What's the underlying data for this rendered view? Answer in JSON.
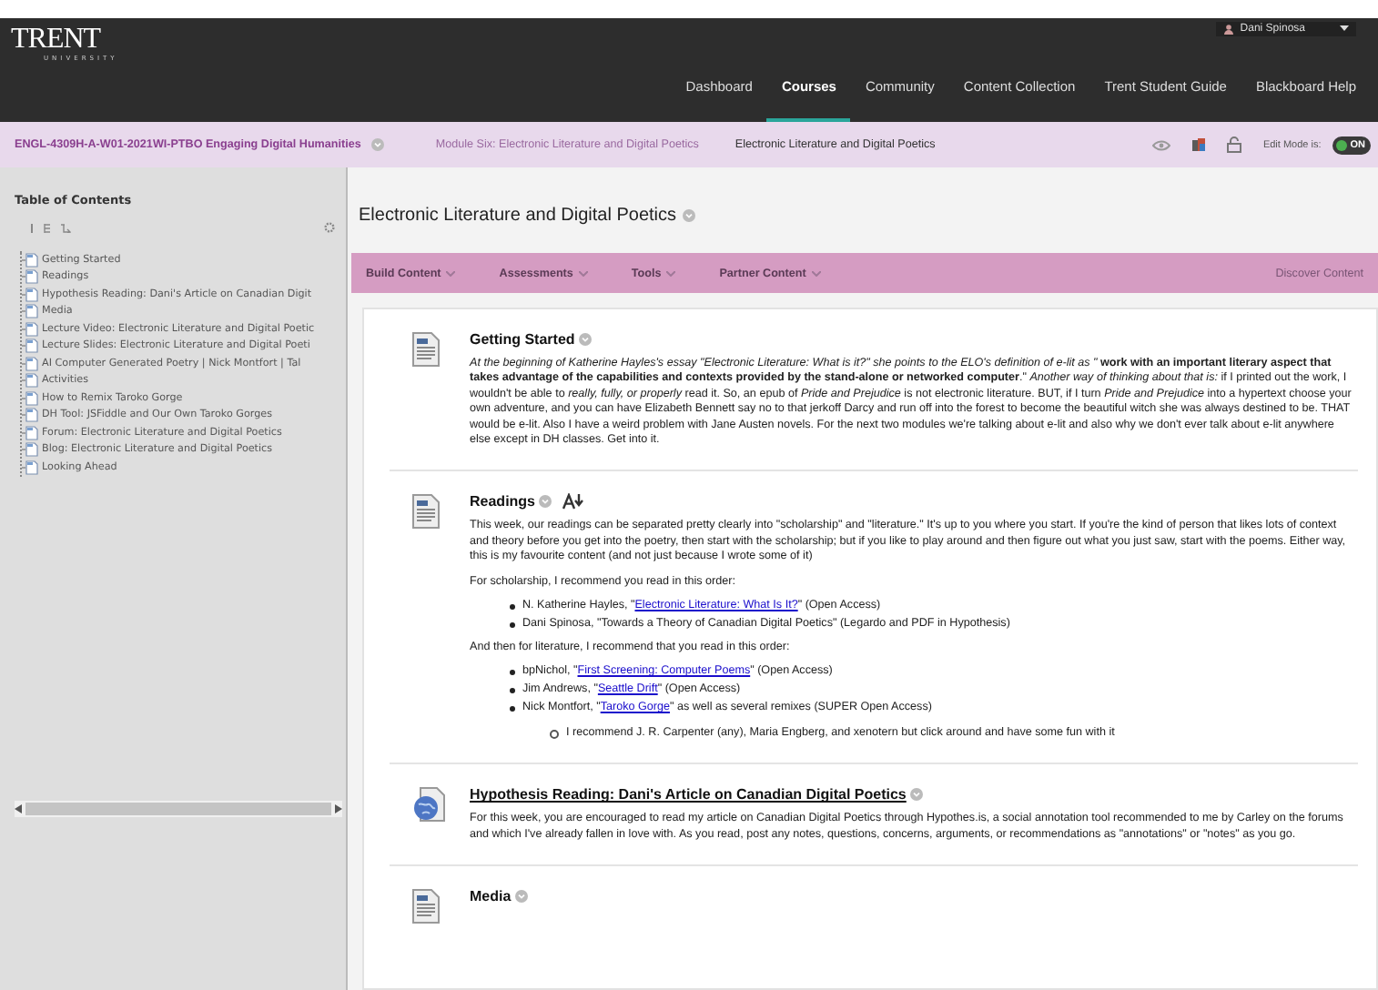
{
  "header": {
    "logo": {
      "name": "TRENT",
      "sub": "UNIVERSITY"
    },
    "user": "Dani Spinosa",
    "nav": [
      {
        "label": "Dashboard",
        "selected": false
      },
      {
        "label": "Courses",
        "selected": true
      },
      {
        "label": "Community",
        "selected": false
      },
      {
        "label": "Content Collection",
        "selected": false
      },
      {
        "label": "Trent Student Guide",
        "selected": false
      },
      {
        "label": "Blackboard Help",
        "selected": false
      }
    ]
  },
  "breadcrumb": {
    "items": [
      "ENGL-4309H-A-W01-2021WI-PTBO Engaging Digital Humanities",
      "Module Six: Electronic Literature and Digital Poetics",
      "Electronic Literature and Digital Poetics"
    ],
    "edit_mode": {
      "label": "Edit Mode is:",
      "state": "ON",
      "on": true
    }
  },
  "sidebar": {
    "title": "Table of Contents",
    "items": [
      "Getting Started",
      "Readings",
      "Hypothesis Reading: Dani's Article on Canadian Digit",
      "Media",
      "Lecture Video: Electronic Literature and Digital Poetic",
      "Lecture Slides: Electronic Literature and Digital Poeti",
      "AI Computer Generated Poetry | Nick Montfort | Tal",
      "Activities",
      "How to Remix Taroko Gorge",
      "DH Tool: JSFiddle and Our Own Taroko Gorges",
      "Forum: Electronic Literature and Digital Poetics",
      "Blog: Electronic Literature and Digital Poetics",
      "Looking Ahead"
    ]
  },
  "page_title": "Electronic Literature and Digital Poetics",
  "toolbar": {
    "menus": [
      "Build Content",
      "Assessments",
      "Tools",
      "Partner Content"
    ],
    "right": "Discover Content"
  },
  "items": [
    {
      "kind": "document",
      "title": "Getting Started",
      "alt_formats": false,
      "blocks": [
        {
          "kind": "paragraph",
          "text": "*At the beginning of Katherine Hayles's essay \"Electronic Literature: What is it?\" she points to the ELO's definition of e-lit as \"* **work with an important literary aspect that takes advantage of the capabilities and contexts provided by the stand-alone or networked computer**.\" *Another way of thinking about that is:* if I printed out the work, I wouldn't be able to *really, fully, or properly* read it. So, an epub of *Pride and Prejudice* is not electronic literature. BUT, if I turn *Pride and Prejudice* into a hypertext choose your own adventure, and you can have Elizabeth Bennett say no to that jerkoff Darcy and run off into the forest to become the beautiful witch she was always destined to be. THAT would be e-lit. Also I have a weird problem with Jane Austen novels. For the next two modules we're talking about e-lit and also why we don't ever talk about e-lit anywhere else except in DH classes. Get into it."
        }
      ]
    },
    {
      "kind": "document",
      "title": "Readings",
      "alt_formats": true,
      "blocks": [
        {
          "kind": "paragraph",
          "text": "This week, our readings can be separated pretty clearly into \"scholarship\" and \"literature.\" It's up to you where you start. If you're the kind of person that likes lots of context and theory before you get into the poetry, then start with the scholarship; but if you like to play around and then figure out what you just saw, start with the poems. Either way, this is my favourite content (and not just because I wrote some of it)"
        },
        {
          "kind": "paragraph",
          "text": "For scholarship, I recommend you read in this order:"
        },
        {
          "kind": "list",
          "items": [
            {
              "before": "N. Katherine Hayles, \"",
              "link": "Electronic Literature: What Is It?",
              "after": "\" (Open Access)"
            },
            {
              "before": "Dani Spinosa, \"Towards a Theory of Canadian Digital Poetics\" (Legardo and PDF in Hypothesis)"
            }
          ]
        },
        {
          "kind": "paragraph",
          "text": "And then for literature, I recommend that you read in this order:"
        },
        {
          "kind": "list",
          "items": [
            {
              "before": "bpNichol, \"",
              "link": "First Screening: Computer Poems",
              "after": "\" (Open Access)"
            },
            {
              "before": "Jim Andrews, \"",
              "link": "Seattle Drift",
              "after": "\" (Open Access)"
            },
            {
              "before": "Nick Montfort, \"",
              "link": "Taroko Gorge",
              "after": "\" as well as several remixes (SUPER Open Access)",
              "children": [
                {
                  "before": "I recommend J. R. Carpenter (any), Maria Engberg, and xenotern but click around and have some fun with it"
                }
              ]
            }
          ]
        }
      ]
    },
    {
      "kind": "link",
      "title": "Hypothesis Reading: Dani's Article on Canadian Digital Poetics",
      "alt_formats": false,
      "blocks": [
        {
          "kind": "paragraph",
          "text": "For this week, you are encouraged to read my article on Canadian Digital Poetics through Hypothes.is, a social annotation tool recommended to me by Carley on the forums and which I've already fallen in love with. As you read, post any notes, questions, concerns, arguments, or recommendations as \"annotations\" or \"notes\" as you go."
        }
      ]
    },
    {
      "kind": "document",
      "title": "Media",
      "alt_formats": false
    }
  ]
}
